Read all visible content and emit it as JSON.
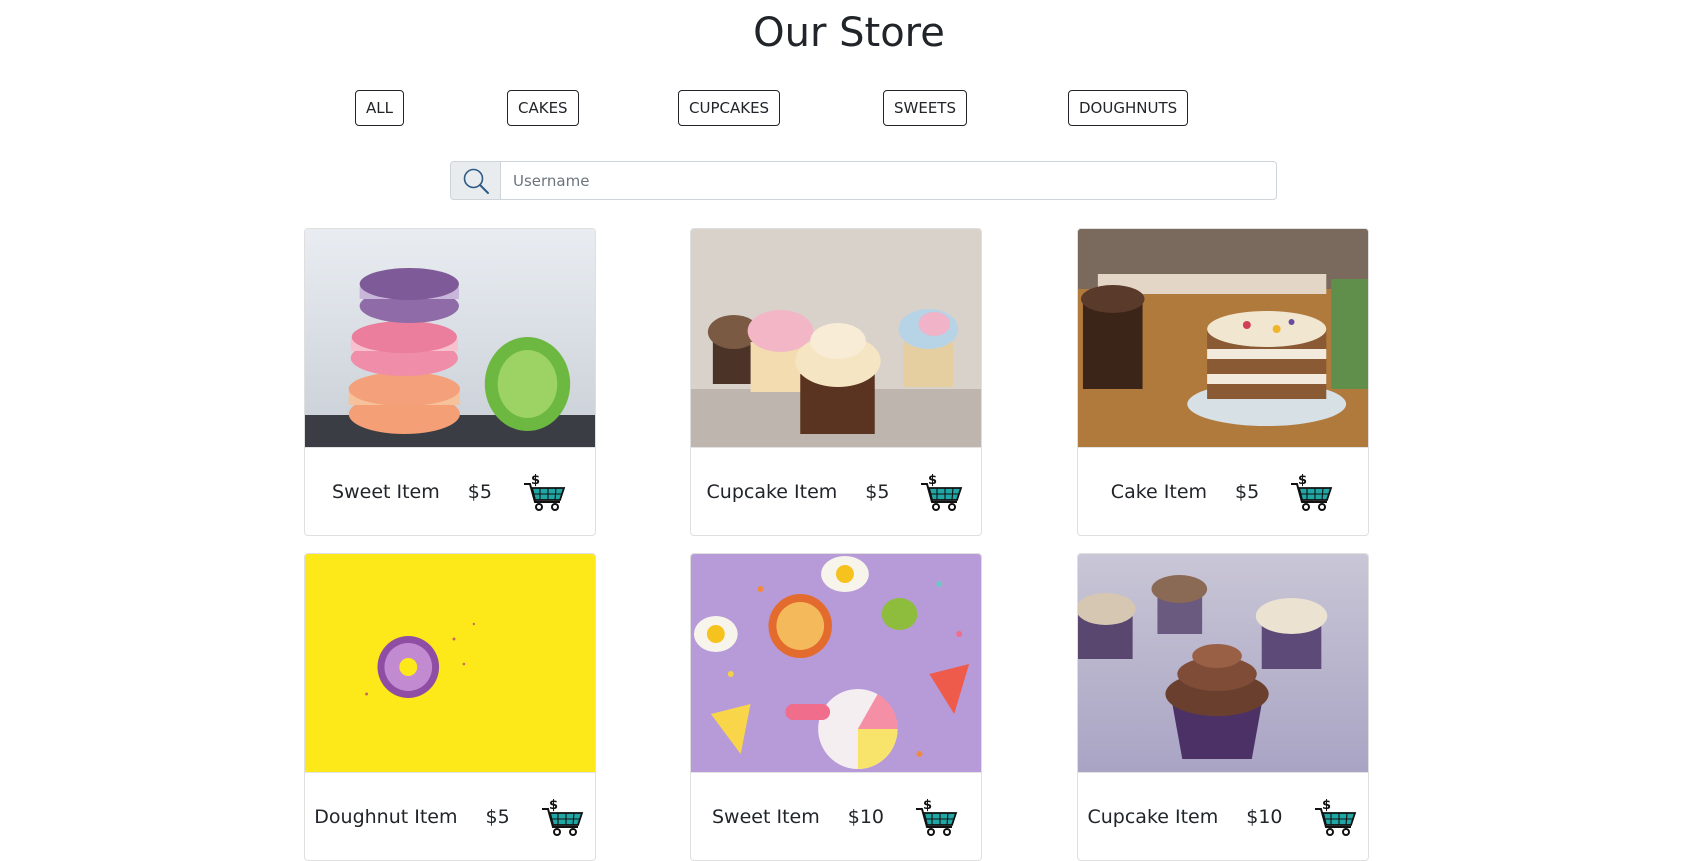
{
  "page": {
    "title": "Our Store"
  },
  "filters": [
    "ALL",
    "CAKES",
    "CUPCAKES",
    "SWEETS",
    "DOUGHNUTS"
  ],
  "search": {
    "placeholder": "Username",
    "value": ""
  },
  "products": [
    {
      "name": "Sweet Item",
      "price": "$5",
      "image": "macarons"
    },
    {
      "name": "Cupcake Item",
      "price": "$5",
      "image": "cupcakes-row"
    },
    {
      "name": "Cake Item",
      "price": "$5",
      "image": "layer-cake"
    },
    {
      "name": "Doughnut Item",
      "price": "$5",
      "image": "doughnut"
    },
    {
      "name": "Sweet Item",
      "price": "$10",
      "image": "candy-sprinkles"
    },
    {
      "name": "Cupcake Item",
      "price": "$10",
      "image": "chocolate-cupcake"
    }
  ],
  "icons": {
    "search": "search-icon",
    "cart": "shopping-cart-dollar-icon"
  },
  "colors": {
    "cart_teal": "#21a6a6",
    "search_addon_bg": "#e9ecef",
    "text": "#212529"
  }
}
